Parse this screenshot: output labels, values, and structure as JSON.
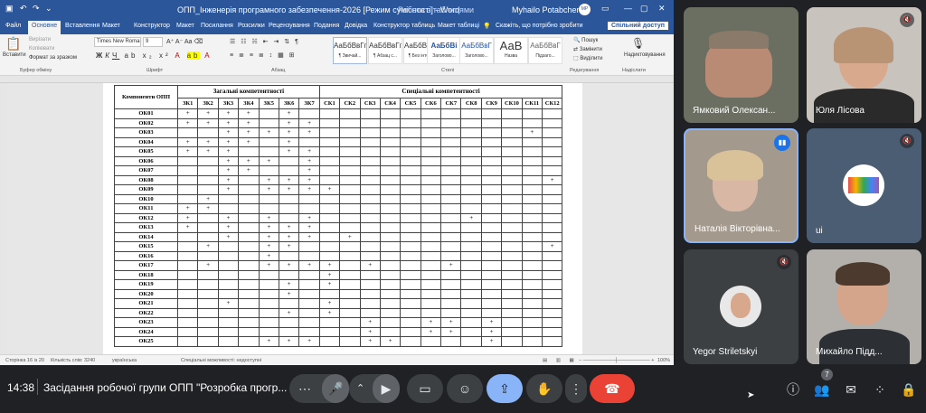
{
  "word": {
    "title": "ОПП_Інженерія програмного забезпечення-2026 [Режим сумісності] - Word",
    "context_tab": "Робота з таблицями",
    "user": "Myhailo Potabchenko",
    "user_initials": "MP",
    "menu": [
      "Файл",
      "Основне",
      "Вставлення",
      "Макет",
      "Конструктор",
      "Макет",
      "Посилання",
      "Розсилки",
      "Рецензування",
      "Подання",
      "Довідка",
      "Конструктор таблиць",
      "Макет таблиці"
    ],
    "tell_me": "Скажіть, що потрібно зробити",
    "share": "Спільний доступ",
    "ribbon": {
      "paste": "Вставити",
      "cut": "Вирізати",
      "copy": "Копіювати",
      "format_painter": "Формат за зразком",
      "clipboard_group": "Буфер обміну",
      "font_name": "Times New Roman",
      "font_size": "9",
      "font_group": "Шрифт",
      "paragraph_group": "Абзац",
      "styles": [
        {
          "preview": "АаБбВвГг,",
          "name": "¶ Звичай..."
        },
        {
          "preview": "АаБбВвГг,",
          "name": "¶ Абзац с..."
        },
        {
          "preview": "АаБбВвГг,",
          "name": "¶ Без інте..."
        },
        {
          "preview": "АаБбВі",
          "name": "Заголово..."
        },
        {
          "preview": "АаБбВвГ",
          "name": "Заголово..."
        },
        {
          "preview": "АаВ",
          "name": "Назва"
        },
        {
          "preview": "АаБбВвГ",
          "name": "Підзаго..."
        }
      ],
      "styles_group": "Стилі",
      "find": "Пошук",
      "replace": "Замінити",
      "select": "Виділити",
      "editing_group": "Редагування",
      "dictate": "Надиктовування",
      "voice_group": "Надіслати"
    },
    "status": {
      "page": "Сторінка 16 із 20",
      "words": "Кількість слів: 3240",
      "lang": "українська",
      "accessibility": "Спеціальні можливості: недоступні",
      "zoom": "100%"
    }
  },
  "table": {
    "row_header": "Компоненти ОПП",
    "group_general": "Загальні компетентності",
    "group_special": "Спеціальні компетентності",
    "general_cols": [
      "ЗК1",
      "ЗК2",
      "ЗК3",
      "ЗК4",
      "ЗК5",
      "ЗК6",
      "ЗК7"
    ],
    "special_cols": [
      "СК1",
      "СК2",
      "СК3",
      "СК4",
      "СК5",
      "СК6",
      "СК7",
      "СК8",
      "СК9",
      "СК10",
      "СК11",
      "СК12"
    ],
    "rows": [
      {
        "name": "ОК01",
        "g": [
          "+",
          "+",
          "+",
          "+",
          "",
          "+",
          ""
        ],
        "s": [
          "",
          "",
          "",
          "",
          "",
          "",
          "",
          "",
          "",
          "",
          "",
          ""
        ]
      },
      {
        "name": "ОК02",
        "g": [
          "+",
          "+",
          "+",
          "+",
          "",
          "+",
          "+"
        ],
        "s": [
          "",
          "",
          "",
          "",
          "",
          "",
          "",
          "",
          "",
          "",
          "",
          ""
        ]
      },
      {
        "name": "ОК03",
        "g": [
          "",
          "",
          "+",
          "+",
          "+",
          "+",
          "+"
        ],
        "s": [
          "",
          "",
          "",
          "",
          "",
          "",
          "",
          "",
          "",
          "",
          "+",
          ""
        ]
      },
      {
        "name": "ОК04",
        "g": [
          "+",
          "+",
          "+",
          "+",
          "",
          "+",
          ""
        ],
        "s": [
          "",
          "",
          "",
          "",
          "",
          "",
          "",
          "",
          "",
          "",
          "",
          ""
        ]
      },
      {
        "name": "ОК05",
        "g": [
          "+",
          "+",
          "+",
          "",
          "",
          "+",
          "+"
        ],
        "s": [
          "",
          "",
          "",
          "",
          "",
          "",
          "",
          "",
          "",
          "",
          "",
          ""
        ]
      },
      {
        "name": "ОК06",
        "g": [
          "",
          "",
          "+",
          "+",
          "+",
          "",
          "+"
        ],
        "s": [
          "",
          "",
          "",
          "",
          "",
          "",
          "",
          "",
          "",
          "",
          "",
          ""
        ]
      },
      {
        "name": "ОК07",
        "g": [
          "",
          "",
          "+",
          "+",
          "",
          "",
          "+"
        ],
        "s": [
          "",
          "",
          "",
          "",
          "",
          "",
          "",
          "",
          "",
          "",
          "",
          ""
        ]
      },
      {
        "name": "ОК08",
        "g": [
          "",
          "",
          "+",
          "",
          "+",
          "+",
          "+"
        ],
        "s": [
          "",
          "",
          "",
          "",
          "",
          "",
          "",
          "",
          "",
          "",
          "",
          "+"
        ]
      },
      {
        "name": "ОК09",
        "g": [
          "",
          "",
          "+",
          "",
          "+",
          "+",
          "+"
        ],
        "s": [
          "+",
          "",
          "",
          "",
          "",
          "",
          "",
          "",
          "",
          "",
          "",
          ""
        ]
      },
      {
        "name": "ОК10",
        "g": [
          "",
          "+",
          "",
          "",
          "",
          "",
          ""
        ],
        "s": [
          "",
          "",
          "",
          "",
          "",
          "",
          "",
          "",
          "",
          "",
          "",
          ""
        ]
      },
      {
        "name": "ОК11",
        "g": [
          "+",
          "+",
          "",
          "",
          "",
          "",
          ""
        ],
        "s": [
          "",
          "",
          "",
          "",
          "",
          "",
          "",
          "",
          "",
          "",
          "",
          ""
        ]
      },
      {
        "name": "ОК12",
        "g": [
          "+",
          "",
          "+",
          "",
          "+",
          "",
          "+"
        ],
        "s": [
          "",
          "",
          "",
          "",
          "",
          "",
          "",
          "+",
          "",
          "",
          "",
          ""
        ]
      },
      {
        "name": "ОК13",
        "g": [
          "+",
          "",
          "+",
          "",
          "+",
          "+",
          "+"
        ],
        "s": [
          "",
          "",
          "",
          "",
          "",
          "",
          "",
          "",
          "",
          "",
          "",
          ""
        ]
      },
      {
        "name": "ОК14",
        "g": [
          "",
          "",
          "+",
          "",
          "+",
          "+",
          "+"
        ],
        "s": [
          "",
          "+",
          "",
          "",
          "",
          "",
          "",
          "",
          "",
          "",
          "",
          ""
        ]
      },
      {
        "name": "ОК15",
        "g": [
          "",
          "+",
          "",
          "",
          "+",
          "+",
          ""
        ],
        "s": [
          "",
          "",
          "",
          "",
          "",
          "",
          "",
          "",
          "",
          "",
          "",
          "+"
        ]
      },
      {
        "name": "ОК16",
        "g": [
          "",
          "",
          "",
          "",
          "+",
          "",
          ""
        ],
        "s": [
          "",
          "",
          "",
          "",
          "",
          "",
          "",
          "",
          "",
          "",
          "",
          ""
        ]
      },
      {
        "name": "ОК17",
        "g": [
          "",
          "+",
          "",
          "",
          "+",
          "+",
          "+"
        ],
        "s": [
          "+",
          "",
          "+",
          "",
          "",
          "",
          "+",
          "",
          "",
          "",
          "",
          ""
        ]
      },
      {
        "name": "ОК18",
        "g": [
          "",
          "",
          "",
          "",
          "",
          "",
          ""
        ],
        "s": [
          "+",
          "",
          "",
          "",
          "",
          "",
          "",
          "",
          "",
          "",
          "",
          ""
        ]
      },
      {
        "name": "ОК19",
        "g": [
          "",
          "",
          "",
          "",
          "",
          "+",
          ""
        ],
        "s": [
          "+",
          "",
          "",
          "",
          "",
          "",
          "",
          "",
          "",
          "",
          "",
          ""
        ]
      },
      {
        "name": "ОК20",
        "g": [
          "",
          "",
          "",
          "",
          "",
          "+",
          ""
        ],
        "s": [
          "",
          "",
          "",
          "",
          "",
          "",
          "",
          "",
          "",
          "",
          "",
          ""
        ]
      },
      {
        "name": "ОК21",
        "g": [
          "",
          "",
          "+",
          "",
          "",
          "",
          ""
        ],
        "s": [
          "+",
          "",
          "",
          "",
          "",
          "",
          "",
          "",
          "",
          "",
          "",
          ""
        ]
      },
      {
        "name": "ОК22",
        "g": [
          "",
          "",
          "",
          "",
          "",
          "+",
          ""
        ],
        "s": [
          "+",
          "",
          "",
          "",
          "",
          "",
          "",
          "",
          "",
          "",
          "",
          ""
        ]
      },
      {
        "name": "ОК23",
        "g": [
          "",
          "",
          "",
          "",
          "",
          "",
          ""
        ],
        "s": [
          "",
          "",
          "+",
          "",
          "",
          "+",
          "+",
          "",
          "+",
          "",
          "",
          ""
        ]
      },
      {
        "name": "ОК24",
        "g": [
          "",
          "",
          "",
          "",
          "",
          "",
          ""
        ],
        "s": [
          "",
          "",
          "+",
          "",
          "",
          "+",
          "+",
          "",
          "+",
          "",
          "",
          ""
        ]
      },
      {
        "name": "ОК25",
        "g": [
          "",
          "",
          "",
          "",
          "+",
          "+",
          "+"
        ],
        "s": [
          "",
          "",
          "+",
          "+",
          "",
          "",
          "",
          "",
          "+",
          "",
          "",
          ""
        ]
      }
    ]
  },
  "participants": [
    {
      "name": "Ямковий Олексан...",
      "muted": false
    },
    {
      "name": "Юля Лісова",
      "muted": true
    },
    {
      "name": "Наталія Вікторівна...",
      "muted": false,
      "speaking": true
    },
    {
      "name": "ui",
      "muted": true
    },
    {
      "name": "Yegor Striletskyi",
      "muted": true
    },
    {
      "name": "Михайло Підд...",
      "muted": false
    }
  ],
  "meet": {
    "time": "14:38",
    "title": "Засідання робочої групи ОПП \"Розробка прогр...",
    "participant_count": "7"
  },
  "colors": {
    "word_blue": "#2b579a",
    "meet_bg": "#202124",
    "tile_bg": "#3c4043",
    "end_call": "#ea4335",
    "present_active": "#8ab4f8",
    "speaking": "#1a73e8"
  }
}
